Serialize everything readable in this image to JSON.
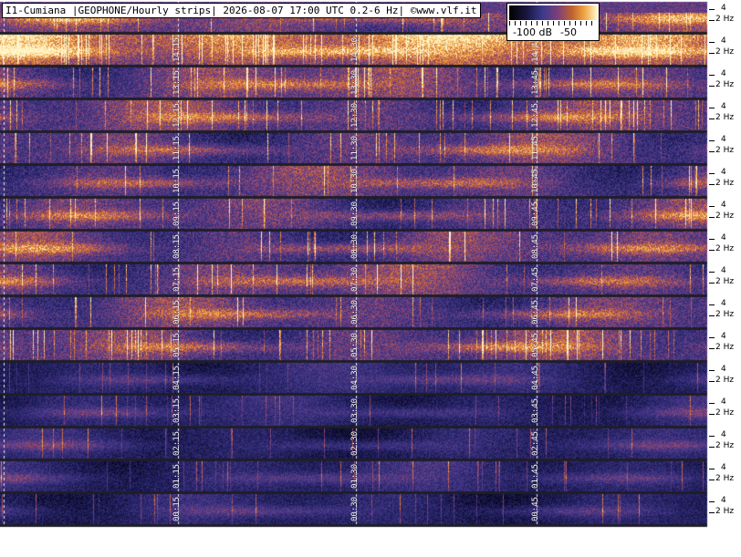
{
  "header": {
    "title": "I1-Cumiana |GEOPHONE/Hourly strips| 2026-08-07 17:00 UTC 0.2-6 Hz| ©www.vlf.it"
  },
  "colorbar": {
    "low_label": "-100 dB",
    "high_label": "-50",
    "colors": [
      "#000000",
      "#1a1640",
      "#3b3a8c",
      "#7a3f7c",
      "#c0642e",
      "#f0a646",
      "#fff4c8"
    ]
  },
  "axis": {
    "upper_label": "4",
    "lower_label": "2 Hz"
  },
  "strips": [
    {
      "labels": [
        "",
        "",
        ""
      ],
      "intensity": 0.55,
      "style": "hot-top"
    },
    {
      "labels": [
        "14:15",
        "14:30",
        "14:45"
      ],
      "intensity": 0.75,
      "style": "hot"
    },
    {
      "labels": [
        "13:15",
        "13:30",
        "13:45"
      ],
      "intensity": 0.55,
      "style": "busy"
    },
    {
      "labels": [
        "12:15",
        "12:30",
        "12:45"
      ],
      "intensity": 0.5,
      "style": "busy"
    },
    {
      "labels": [
        "11:15",
        "11:30",
        "11:45"
      ],
      "intensity": 0.45,
      "style": "mid"
    },
    {
      "labels": [
        "10:15",
        "10:30",
        "10:45"
      ],
      "intensity": 0.45,
      "style": "mid"
    },
    {
      "labels": [
        "09:15",
        "09:30",
        "09:45"
      ],
      "intensity": 0.4,
      "style": "mid"
    },
    {
      "labels": [
        "08:15",
        "08:30",
        "08:45"
      ],
      "intensity": 0.45,
      "style": "mid"
    },
    {
      "labels": [
        "07:15",
        "07:30",
        "07:45"
      ],
      "intensity": 0.5,
      "style": "mid"
    },
    {
      "labels": [
        "06:15",
        "06:30",
        "06:45"
      ],
      "intensity": 0.45,
      "style": "mid"
    },
    {
      "labels": [
        "05:15",
        "05:30",
        "05:45"
      ],
      "intensity": 0.5,
      "style": "busy"
    },
    {
      "labels": [
        "04:15",
        "04:30",
        "04:45"
      ],
      "intensity": 0.3,
      "style": "quiet"
    },
    {
      "labels": [
        "03:15",
        "03:30",
        "03:45"
      ],
      "intensity": 0.25,
      "style": "quiet"
    },
    {
      "labels": [
        "02:15",
        "02:30",
        "02:45"
      ],
      "intensity": 0.2,
      "style": "quiet"
    },
    {
      "labels": [
        "01:15",
        "01:30",
        "01:45"
      ],
      "intensity": 0.3,
      "style": "quiet"
    },
    {
      "labels": [
        "00:15",
        "00:30",
        "00:45"
      ],
      "intensity": 0.22,
      "style": "quiet"
    }
  ]
}
